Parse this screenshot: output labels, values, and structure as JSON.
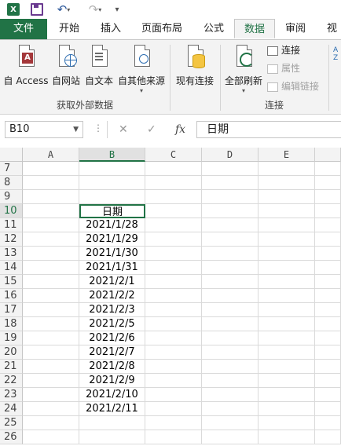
{
  "qat": {
    "excel_logo": "X",
    "undo_icon": "undo-icon",
    "redo_icon": "redo-icon",
    "customize_icon": "customize-icon"
  },
  "tabs": [
    {
      "label": "文件",
      "kind": "file"
    },
    {
      "label": "开始"
    },
    {
      "label": "插入"
    },
    {
      "label": "页面布局"
    },
    {
      "label": "公式"
    },
    {
      "label": "数据",
      "kind": "active"
    },
    {
      "label": "审阅"
    },
    {
      "label": "视图"
    }
  ],
  "ribbon": {
    "get_external": {
      "buttons": [
        "自 Access",
        "自网站",
        "自文本",
        "自其他来源"
      ],
      "group_label": "获取外部数据"
    },
    "existing_conn": "现有连接",
    "connections": {
      "refresh_all": "全部刷新",
      "connections": "连接",
      "properties": "属性",
      "edit_links": "编辑链接",
      "group_label": "连接"
    },
    "partial_right": "A Z"
  },
  "formula_bar": {
    "name_box": "B10",
    "more": "⋮",
    "cancel": "✕",
    "enter": "✓",
    "fx": "fx",
    "value": "日期"
  },
  "grid": {
    "columns": [
      "A",
      "B",
      "C",
      "D",
      "E",
      ""
    ],
    "selected_column": "B",
    "rows": [
      {
        "num": "7",
        "b": ""
      },
      {
        "num": "8",
        "b": ""
      },
      {
        "num": "9",
        "b": ""
      },
      {
        "num": "10",
        "b": "日期"
      },
      {
        "num": "11",
        "b": "2021/1/28"
      },
      {
        "num": "12",
        "b": "2021/1/29"
      },
      {
        "num": "13",
        "b": "2021/1/30"
      },
      {
        "num": "14",
        "b": "2021/1/31"
      },
      {
        "num": "15",
        "b": "2021/2/1"
      },
      {
        "num": "16",
        "b": "2021/2/2"
      },
      {
        "num": "17",
        "b": "2021/2/3"
      },
      {
        "num": "18",
        "b": "2021/2/5"
      },
      {
        "num": "19",
        "b": "2021/2/6"
      },
      {
        "num": "20",
        "b": "2021/2/7"
      },
      {
        "num": "21",
        "b": "2021/2/8"
      },
      {
        "num": "22",
        "b": "2021/2/9"
      },
      {
        "num": "23",
        "b": "2021/2/10"
      },
      {
        "num": "24",
        "b": "2021/2/11"
      },
      {
        "num": "25",
        "b": ""
      },
      {
        "num": "26",
        "b": ""
      }
    ],
    "selected_row": "10"
  }
}
